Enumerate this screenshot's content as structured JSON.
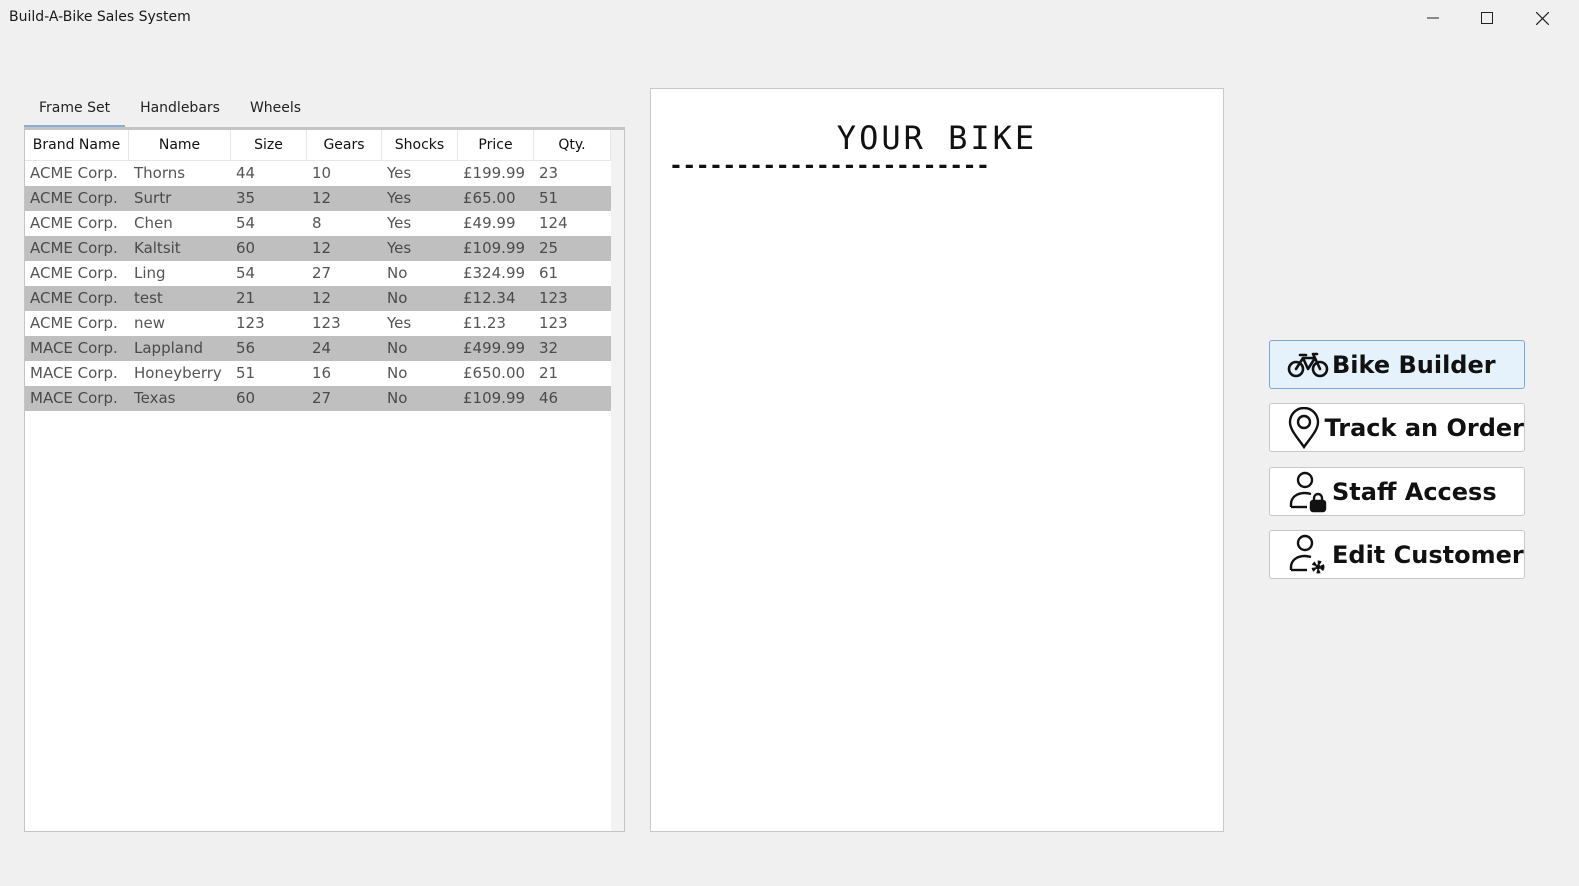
{
  "window": {
    "title": "Build-A-Bike Sales System",
    "controls": {
      "minimize": "minimize-icon",
      "maximize": "maximize-icon",
      "close": "close-icon"
    }
  },
  "tabs": [
    {
      "label": "Frame Set",
      "active": true
    },
    {
      "label": "Handlebars",
      "active": false
    },
    {
      "label": "Wheels",
      "active": false
    }
  ],
  "table": {
    "columns": [
      "Brand Name",
      "Name",
      "Size",
      "Gears",
      "Shocks",
      "Price",
      "Qty."
    ],
    "rows": [
      [
        "ACME Corp.",
        "Thorns",
        "44",
        "10",
        "Yes",
        "£199.99",
        "23"
      ],
      [
        "ACME Corp.",
        "Surtr",
        "35",
        "12",
        "Yes",
        "£65.00",
        "51"
      ],
      [
        "ACME Corp.",
        "Chen",
        "54",
        "8",
        "Yes",
        "£49.99",
        "124"
      ],
      [
        "ACME Corp.",
        "Kaltsit",
        "60",
        "12",
        "Yes",
        "£109.99",
        "25"
      ],
      [
        "ACME Corp.",
        "Ling",
        "54",
        "27",
        "No",
        "£324.99",
        "61"
      ],
      [
        "ACME Corp.",
        "test",
        "21",
        "12",
        "No",
        "£12.34",
        "123"
      ],
      [
        "ACME Corp.",
        "new",
        "123",
        "123",
        "Yes",
        "£1.23",
        "123"
      ],
      [
        "MACE Corp.",
        "Lappland",
        "56",
        "24",
        "No",
        "£499.99",
        "32"
      ],
      [
        "MACE Corp.",
        "Honeyberry",
        "51",
        "16",
        "No",
        "£650.00",
        "21"
      ],
      [
        "MACE Corp.",
        "Texas",
        "60",
        "27",
        "No",
        "£109.99",
        "46"
      ]
    ]
  },
  "bike_panel": {
    "title": "YOUR BIKE",
    "divider": "------------------------"
  },
  "nav_buttons": [
    {
      "label": "Bike Builder",
      "icon": "bicycle-icon",
      "active": true
    },
    {
      "label": "Track an Order",
      "icon": "location-pin-icon",
      "active": false
    },
    {
      "label": "Staff Access",
      "icon": "user-lock-icon",
      "active": false
    },
    {
      "label": "Edit Customer",
      "icon": "user-gear-icon",
      "active": false
    }
  ]
}
